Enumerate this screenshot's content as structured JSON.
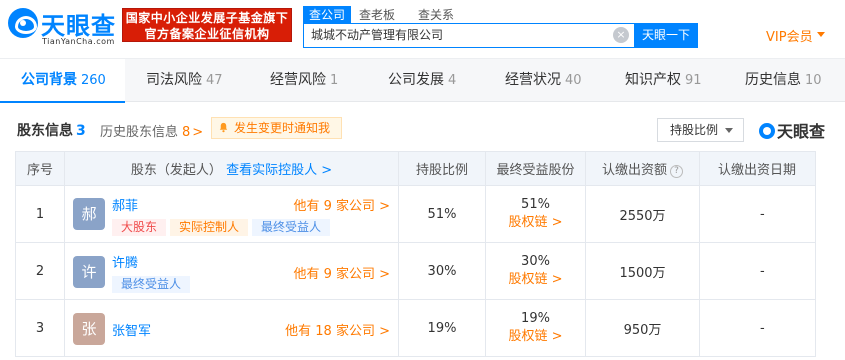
{
  "brand": {
    "logo_text": "天眼查",
    "logo_sub": "TianYanCha.com",
    "badge_line1": "国家中小企业发展子基金旗下",
    "badge_line2": "官方备案企业征信机构",
    "color": "#0084ff"
  },
  "search": {
    "tabs": [
      "查公司",
      "查老板",
      "查关系"
    ],
    "value": "城城不动产管理有限公司",
    "button": "天眼一下",
    "clear": "×"
  },
  "vip": {
    "label": "VIP会员"
  },
  "nav": [
    {
      "label": "公司背景",
      "count": "260"
    },
    {
      "label": "司法风险",
      "count": "47"
    },
    {
      "label": "经营风险",
      "count": "1"
    },
    {
      "label": "公司发展",
      "count": "4"
    },
    {
      "label": "经营状况",
      "count": "40"
    },
    {
      "label": "知识产权",
      "count": "91"
    },
    {
      "label": "历史信息",
      "count": "10"
    }
  ],
  "section": {
    "title": "股东信息",
    "count": "3",
    "history_label": "历史股东信息",
    "history_count": "8",
    "history_arrow": ">",
    "notify": "发生变更时通知我",
    "ratio_select": "持股比例",
    "watermark": "天眼查"
  },
  "table": {
    "headers": {
      "index": "序号",
      "holder": "股东（发起人）",
      "holder_link": "查看实际控股人 >",
      "ratio": "持股比例",
      "final": "最终受益股份",
      "capital": "认缴出资额",
      "date": "认缴出资日期"
    },
    "help": "?",
    "rows": [
      {
        "index": "1",
        "avatar": "郝",
        "avatar_color": "#8aa3c8",
        "name": "郝菲",
        "other": "他有 9 家公司 >",
        "tags": [
          "大股东",
          "实际控制人",
          "最终受益人"
        ],
        "ratio": "51%",
        "final": "51%",
        "chain": "股权链 >",
        "capital": "2550万",
        "date": "-"
      },
      {
        "index": "2",
        "avatar": "许",
        "avatar_color": "#8aa3c8",
        "name": "许腾",
        "other": "他有 9 家公司 >",
        "tags": [
          "最终受益人"
        ],
        "ratio": "30%",
        "final": "30%",
        "chain": "股权链 >",
        "capital": "1500万",
        "date": "-"
      },
      {
        "index": "3",
        "avatar": "张",
        "avatar_color": "#c9a79a",
        "name": "张智军",
        "other": "他有 18 家公司 >",
        "tags": [],
        "ratio": "19%",
        "final": "19%",
        "chain": "股权链 >",
        "capital": "950万",
        "date": "-"
      }
    ]
  }
}
